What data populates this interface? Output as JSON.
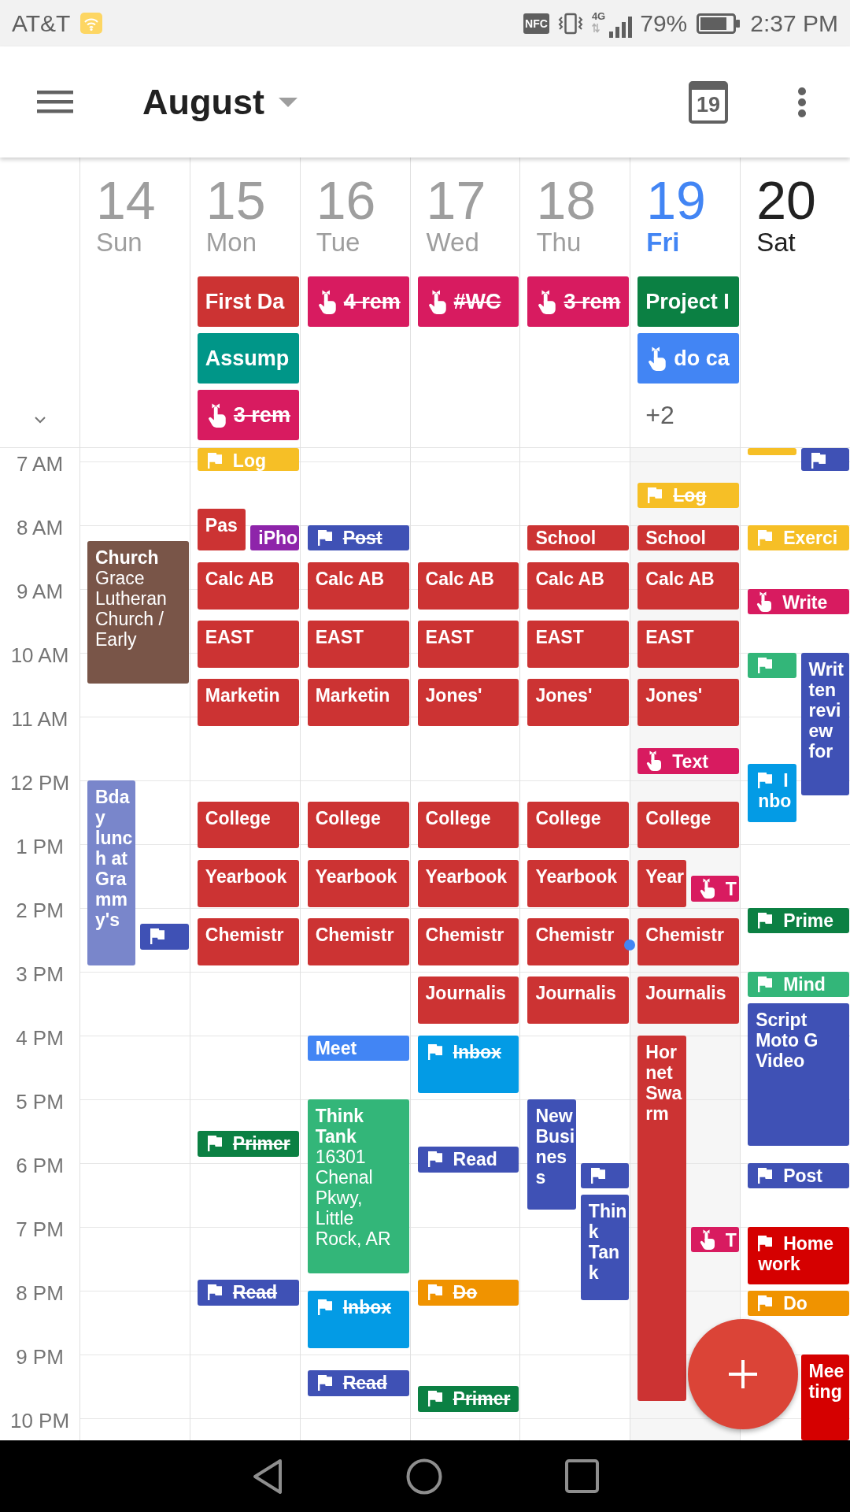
{
  "status_bar": {
    "carrier": "AT&T",
    "nfc": "NFC",
    "network": "4G",
    "battery": "79%",
    "time": "2:37 PM"
  },
  "app_bar": {
    "title": "August",
    "today_button": "19"
  },
  "hours": [
    "7 AM",
    "8 AM",
    "9 AM",
    "10 AM",
    "11 AM",
    "12 PM",
    "1 PM",
    "2 PM",
    "3 PM",
    "4 PM",
    "5 PM",
    "6 PM",
    "7 PM",
    "8 PM",
    "9 PM",
    "10 PM"
  ],
  "days": [
    {
      "number": "14",
      "name": "Sun",
      "past": true,
      "today": false,
      "events": [
        {
          "kind": "event",
          "title": "Church",
          "detail": "Grace Lutheran Church / Early",
          "color": "#795548"
        },
        {
          "kind": "event",
          "title": "Bday lunch at Grammy's",
          "color": "#7986cb"
        },
        {
          "kind": "task",
          "color": "#3f51b5"
        }
      ]
    },
    {
      "number": "15",
      "name": "Mon",
      "past": true,
      "today": false,
      "all_day": [
        {
          "kind": "event",
          "title": "First Da",
          "color": "#cc3333"
        },
        {
          "kind": "event",
          "title": "Assump",
          "color": "#009688"
        },
        {
          "kind": "reminder",
          "title": "3 rem",
          "color": "#d81b60",
          "done": true
        }
      ],
      "events": [
        {
          "kind": "task",
          "title": "Log",
          "color": "#f6bf26",
          "done": false
        },
        {
          "kind": "event",
          "title": "Pas",
          "color": "#cc3333"
        },
        {
          "kind": "event",
          "title": "iPho",
          "color": "#8e24aa"
        },
        {
          "kind": "event",
          "title": "Calc AB",
          "color": "#cc3333"
        },
        {
          "kind": "event",
          "title": "EAST",
          "color": "#cc3333"
        },
        {
          "kind": "event",
          "title": "Marketin",
          "color": "#cc3333"
        },
        {
          "kind": "event",
          "title": "College",
          "color": "#cc3333"
        },
        {
          "kind": "event",
          "title": "Yearbook",
          "color": "#cc3333"
        },
        {
          "kind": "event",
          "title": "Chemistr",
          "color": "#cc3333"
        },
        {
          "kind": "task",
          "title": "Primer",
          "color": "#0b8043",
          "done": true
        },
        {
          "kind": "task",
          "title": "Read",
          "color": "#3f51b5",
          "done": true
        }
      ]
    },
    {
      "number": "16",
      "name": "Tue",
      "past": true,
      "today": false,
      "all_day": [
        {
          "kind": "reminder",
          "title": "4 rem",
          "color": "#d81b60",
          "done": true
        }
      ],
      "events": [
        {
          "kind": "task",
          "title": "Post",
          "color": "#3f51b5",
          "done": true
        },
        {
          "kind": "event",
          "title": "Calc AB",
          "color": "#cc3333"
        },
        {
          "kind": "event",
          "title": "EAST",
          "color": "#cc3333"
        },
        {
          "kind": "event",
          "title": "Marketin",
          "color": "#cc3333"
        },
        {
          "kind": "event",
          "title": "College",
          "color": "#cc3333"
        },
        {
          "kind": "event",
          "title": "Yearbook",
          "color": "#cc3333"
        },
        {
          "kind": "event",
          "title": "Chemistr",
          "color": "#cc3333"
        },
        {
          "kind": "event",
          "title": "Meet",
          "color": "#4285f4"
        },
        {
          "kind": "event",
          "title": "Think Tank",
          "detail": "16301 Chenal Pkwy, Little Rock, AR",
          "color": "#33b679"
        },
        {
          "kind": "task",
          "title": "Inbox",
          "color": "#039be5",
          "done": true
        },
        {
          "kind": "task",
          "title": "Read",
          "color": "#3f51b5",
          "done": true
        }
      ]
    },
    {
      "number": "17",
      "name": "Wed",
      "past": true,
      "today": false,
      "all_day": [
        {
          "kind": "reminder",
          "title": "#WC",
          "color": "#d81b60",
          "done": true
        }
      ],
      "events": [
        {
          "kind": "event",
          "title": "Calc AB",
          "color": "#cc3333"
        },
        {
          "kind": "event",
          "title": "EAST",
          "color": "#cc3333"
        },
        {
          "kind": "event",
          "title": "Jones'",
          "color": "#cc3333"
        },
        {
          "kind": "event",
          "title": "College",
          "color": "#cc3333"
        },
        {
          "kind": "event",
          "title": "Yearbook",
          "color": "#cc3333"
        },
        {
          "kind": "event",
          "title": "Chemistr",
          "color": "#cc3333"
        },
        {
          "kind": "event",
          "title": "Journalis",
          "color": "#cc3333"
        },
        {
          "kind": "task",
          "title": "Inbox",
          "color": "#039be5",
          "done": true
        },
        {
          "kind": "task",
          "title": "Read",
          "color": "#3f51b5",
          "done": false
        },
        {
          "kind": "task",
          "title": "Do",
          "color": "#f09300",
          "done": true
        },
        {
          "kind": "task",
          "title": "Primer",
          "color": "#0b8043",
          "done": true
        }
      ]
    },
    {
      "number": "18",
      "name": "Thu",
      "past": true,
      "today": false,
      "all_day": [
        {
          "kind": "reminder",
          "title": "3 rem",
          "color": "#d81b60",
          "done": true
        }
      ],
      "events": [
        {
          "kind": "event",
          "title": "School",
          "color": "#cc3333"
        },
        {
          "kind": "event",
          "title": "Calc AB",
          "color": "#cc3333"
        },
        {
          "kind": "event",
          "title": "EAST",
          "color": "#cc3333"
        },
        {
          "kind": "event",
          "title": "Jones'",
          "color": "#cc3333"
        },
        {
          "kind": "event",
          "title": "College",
          "color": "#cc3333"
        },
        {
          "kind": "event",
          "title": "Yearbook",
          "color": "#cc3333"
        },
        {
          "kind": "event",
          "title": "Chemistr",
          "color": "#cc3333"
        },
        {
          "kind": "event",
          "title": "Journalis",
          "color": "#cc3333"
        },
        {
          "kind": "event",
          "title": "New Business",
          "color": "#3f51b5"
        },
        {
          "kind": "task",
          "color": "#3f51b5"
        },
        {
          "kind": "event",
          "title": "Think Tank",
          "color": "#3f51b5"
        }
      ]
    },
    {
      "number": "19",
      "name": "Fri",
      "past": false,
      "today": true,
      "all_day": [
        {
          "kind": "event",
          "title": "Project I",
          "color": "#0b8043"
        },
        {
          "kind": "reminder",
          "title": "do ca",
          "color": "#4285f4",
          "done": false
        }
      ],
      "more": "+2",
      "events": [
        {
          "kind": "task",
          "title": "Log",
          "color": "#f6bf26",
          "done": true
        },
        {
          "kind": "event",
          "title": "School",
          "color": "#cc3333"
        },
        {
          "kind": "event",
          "title": "Calc AB",
          "color": "#cc3333"
        },
        {
          "kind": "event",
          "title": "EAST",
          "color": "#cc3333"
        },
        {
          "kind": "event",
          "title": "Jones'",
          "color": "#cc3333"
        },
        {
          "kind": "reminder",
          "title": "Text",
          "color": "#d81b60",
          "done": false
        },
        {
          "kind": "event",
          "title": "College",
          "color": "#cc3333"
        },
        {
          "kind": "event",
          "title": "Year",
          "color": "#cc3333"
        },
        {
          "kind": "reminder",
          "title": "T",
          "color": "#d81b60",
          "done": false
        },
        {
          "kind": "event",
          "title": "Chemistr",
          "color": "#cc3333"
        },
        {
          "kind": "event",
          "title": "Journalis",
          "color": "#cc3333"
        },
        {
          "kind": "event",
          "title": "Hornet Swarm",
          "color": "#cc3333"
        },
        {
          "kind": "reminder",
          "title": "T",
          "color": "#d81b60",
          "done": false
        }
      ]
    },
    {
      "number": "20",
      "name": "Sat",
      "past": false,
      "today": false,
      "events": [
        {
          "kind": "task",
          "color": "#f6bf26"
        },
        {
          "kind": "task",
          "color": "#3f51b5"
        },
        {
          "kind": "task",
          "title": "Exerci",
          "color": "#f6bf26",
          "done": false
        },
        {
          "kind": "reminder",
          "title": "Write",
          "color": "#d81b60",
          "done": false
        },
        {
          "kind": "task",
          "color": "#33b679"
        },
        {
          "kind": "event",
          "title": "Written review for",
          "color": "#3f51b5"
        },
        {
          "kind": "task",
          "title": "Inbo",
          "color": "#039be5",
          "done": false
        },
        {
          "kind": "task",
          "title": "Prime",
          "color": "#0b8043",
          "done": false
        },
        {
          "kind": "task",
          "title": "Mind",
          "color": "#33b679",
          "done": false
        },
        {
          "kind": "event",
          "title": "Script Moto G Video",
          "color": "#3f51b5"
        },
        {
          "kind": "task",
          "title": "Post",
          "color": "#3f51b5",
          "done": false
        },
        {
          "kind": "task",
          "title": "Home work",
          "color": "#d50000",
          "done": false
        },
        {
          "kind": "task",
          "title": "Do",
          "color": "#f09300",
          "done": false
        },
        {
          "kind": "event",
          "title": "Meeting",
          "color": "#d50000"
        }
      ]
    }
  ]
}
